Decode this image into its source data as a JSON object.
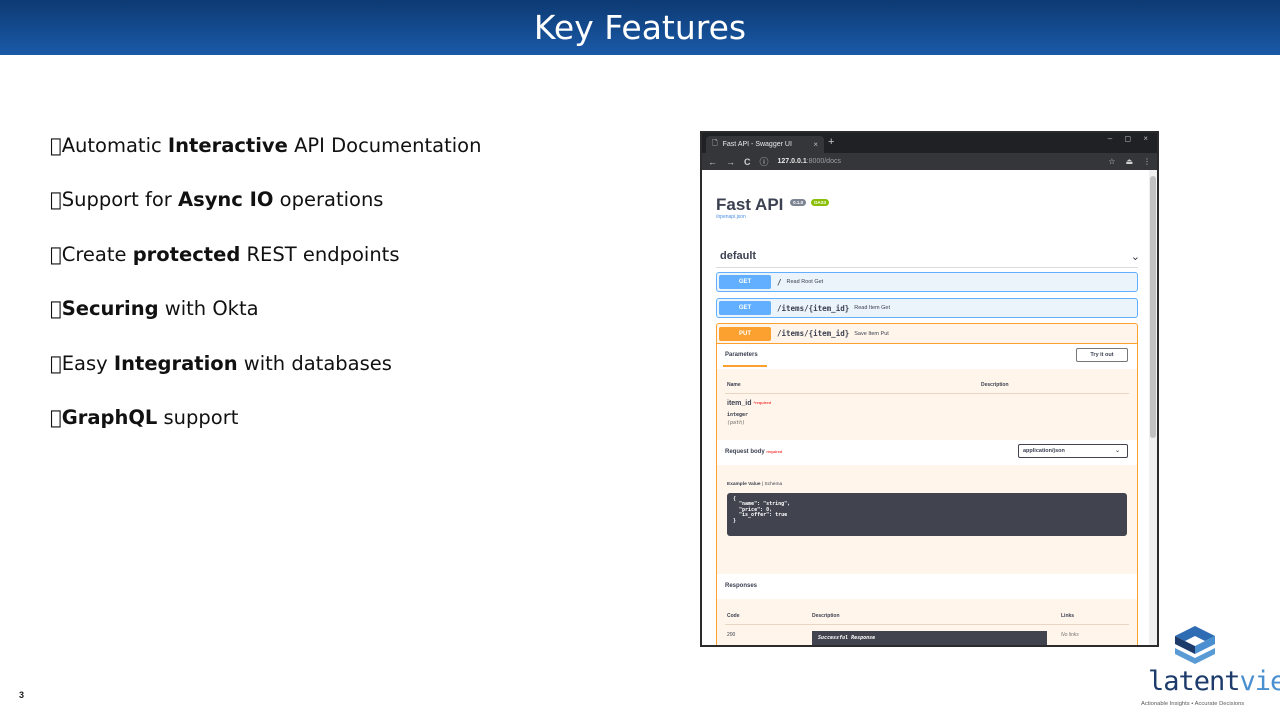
{
  "slide": {
    "title": "Key Features",
    "page_number": "3",
    "features": [
      {
        "pre": "Automatic ",
        "bold": "Interactive",
        "post": " API Documentation"
      },
      {
        "pre": "Support for ",
        "bold": "Async IO",
        "post": " operations"
      },
      {
        "pre": "Create ",
        "bold": "protected",
        "post": " REST endpoints"
      },
      {
        "pre": "",
        "bold": "Securing",
        "post": " with Okta"
      },
      {
        "pre": "Easy ",
        "bold": "Integration",
        "post": " with databases"
      },
      {
        "pre": "",
        "bold": "GraphQL",
        "post": " support"
      }
    ]
  },
  "browser": {
    "tab_title": "Fast API - Swagger UI",
    "tab_close": "×",
    "new_tab": "+",
    "window_controls": "– ◻ ×",
    "url_host": "127.0.0.1",
    "url_path": ":8000/docs",
    "nav": {
      "back": "←",
      "forward": "→",
      "reload": "C",
      "info": "ⓘ"
    },
    "actions": {
      "star": "☆",
      "profile": "⏏",
      "menu": "⋮"
    }
  },
  "swagger": {
    "api_title": "Fast API",
    "version_badge": "0.1.0",
    "oas_badge": "OAS3",
    "openapi_link": "/openapi.json",
    "section": "default",
    "section_chevron": "⌄",
    "operations": [
      {
        "method": "GET",
        "path": "/",
        "summary": "Read Root Get"
      },
      {
        "method": "GET",
        "path": "/items/{item_id}",
        "summary": "Read Item Get"
      }
    ],
    "put": {
      "method": "PUT",
      "path": "/items/{item_id}",
      "summary": "Save Item Put",
      "parameters_label": "Parameters",
      "try_it_out": "Try it out",
      "col_name": "Name",
      "col_description": "Description",
      "param_name": "item_id",
      "param_required_star": "*",
      "param_required": "required",
      "param_type": "integer",
      "param_in": "(path)",
      "request_body_label": "Request body",
      "request_body_required": "required",
      "content_type": "application/json",
      "example_value": "Example Value",
      "schema": "Schema",
      "example_code": "{\n  \"name\": \"string\",\n  \"price\": 0,\n  \"is_offer\": true\n}",
      "responses_label": "Responses",
      "resp_col_code": "Code",
      "resp_col_description": "Description",
      "resp_col_links": "Links",
      "resp_code": "200",
      "resp_description": "Successful Response",
      "resp_links": "No links"
    }
  },
  "logo": {
    "word_left": "latent",
    "word_right": "view",
    "tagline": "Actionable Insights • Accurate Decisions"
  },
  "colors": {
    "header_gradient_top": "#0d3a73",
    "header_gradient_bottom": "#1a5aa8",
    "get_blue": "#61affe",
    "put_orange": "#fca130",
    "logo_dark": "#1c3b6b",
    "logo_light": "#4a8fd0"
  }
}
